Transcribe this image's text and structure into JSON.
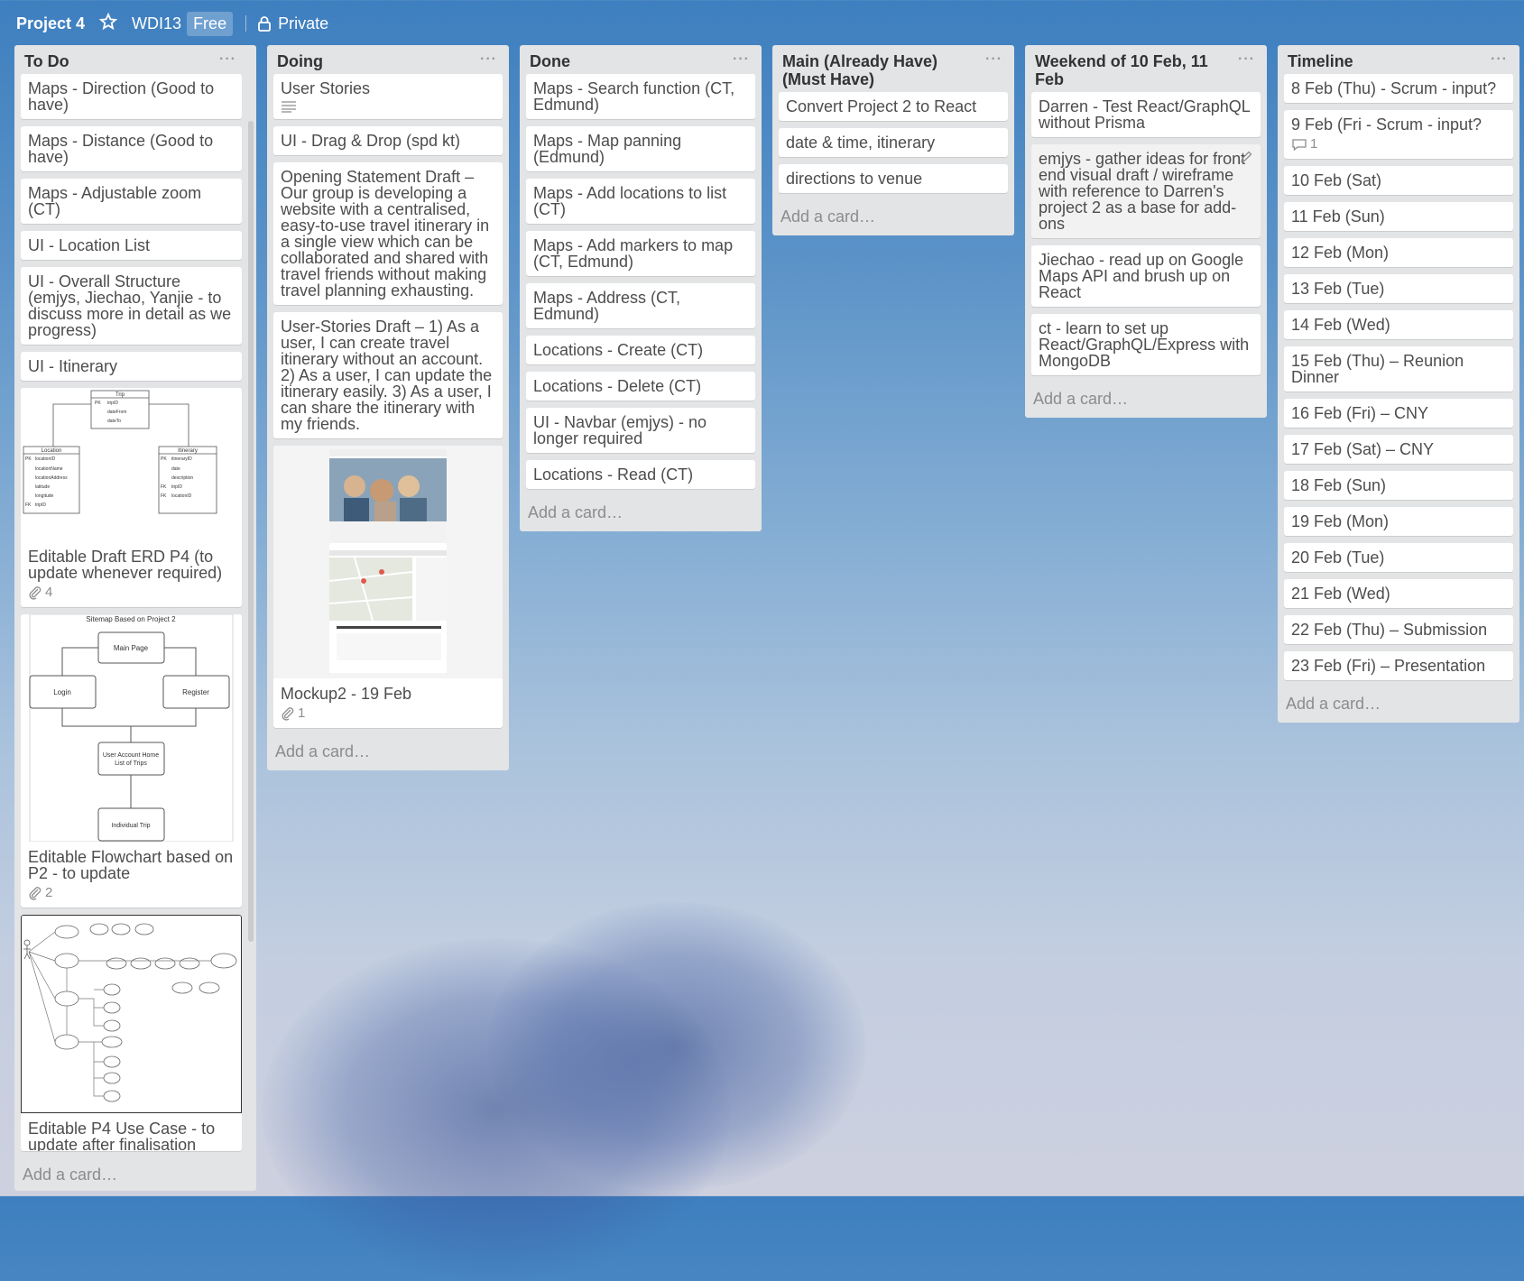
{
  "header": {
    "title": "Project 4",
    "star_icon": "star-icon",
    "workspace": "WDI13",
    "badge": "Free",
    "visibility_icon": "lock-icon",
    "visibility": "Private"
  },
  "lists": [
    {
      "title": "To Do",
      "cards": [
        {
          "text": "Maps - Direction (Good to have)"
        },
        {
          "text": "Maps - Distance (Good to have)"
        },
        {
          "text": "Maps - Adjustable zoom (CT)"
        },
        {
          "text": "UI - Location List"
        },
        {
          "text": "UI - Overall Structure (emjys, Jiechao, Yanjie - to discuss more in detail as we progress)"
        },
        {
          "text": "UI - Itinerary"
        },
        {
          "text": "Editable Draft ERD P4 (to update whenever required)",
          "attachments": "4",
          "erd": {
            "trip": "Trip",
            "trip_fields": [
              "tripID",
              "dateFrom",
              "dateTo"
            ],
            "location": "Location",
            "location_fields": [
              "locationID",
              "locationName",
              "locationAddress",
              "latitude",
              "longitude",
              "tripID"
            ],
            "itinerary": "Itinerary",
            "itinerary_fields": [
              "itineraryID",
              "date",
              "description",
              "tripID",
              "locationID"
            ],
            "pk": "PK",
            "fk": "FK"
          }
        },
        {
          "text": "Editable Flowchart based on P2 - to update",
          "attachments": "2",
          "flow": {
            "title": "Sitemap Based on Project 2",
            "main": "Main Page",
            "login": "Login",
            "register": "Register",
            "home": "User Account Home",
            "home2": "List of Trips",
            "trip": "Individual Trip"
          }
        },
        {
          "text": "Editable P4 Use Case - to update after finalisation"
        }
      ],
      "add": "Add a card…"
    },
    {
      "title": "Doing",
      "cards": [
        {
          "text": "User Stories"
        },
        {
          "text": "UI - Drag & Drop (spd kt)"
        },
        {
          "text": "Opening Statement Draft – Our group is developing a website with a centralised, easy-to-use travel itinerary in a single view which can be collaborated and shared with travel friends without making travel planning exhausting."
        },
        {
          "text": "User-Stories Draft – 1) As a user, I can create travel itinerary without an account. 2) As a user, I can update the itinerary easily. 3) As a user, I can share the itinerary with my friends."
        },
        {
          "text": "Mockup2 - 19 Feb",
          "attachments": "1"
        }
      ],
      "add": "Add a card…"
    },
    {
      "title": "Done",
      "cards": [
        {
          "text": "Maps - Search function (CT, Edmund)"
        },
        {
          "text": "Maps - Map panning (Edmund)"
        },
        {
          "text": "Maps - Add locations to list (CT)"
        },
        {
          "text": "Maps - Add markers to map (CT, Edmund)"
        },
        {
          "text": "Maps - Address (CT, Edmund)"
        },
        {
          "text": "Locations - Create (CT)"
        },
        {
          "text": "Locations - Delete (CT)"
        },
        {
          "text": "UI - Navbar (emjys) - no longer required"
        },
        {
          "text": "Locations - Read (CT)"
        }
      ],
      "add": "Add a card…"
    },
    {
      "title": "Main (Already Have) (Must Have)",
      "cards": [
        {
          "text": "Convert Project 2 to React"
        },
        {
          "text": "date & time, itinerary"
        },
        {
          "text": "directions to venue"
        }
      ],
      "add": "Add a card…"
    },
    {
      "title": "Weekend of 10 Feb, 11 Feb",
      "cards": [
        {
          "text": "Darren - Test React/GraphQL without Prisma"
        },
        {
          "text": "emjys - gather ideas for front end visual draft / wireframe with reference to Darren's project 2 as a base for add-ons"
        },
        {
          "text": "Jiechao - read up on Google Maps API and brush up on React"
        },
        {
          "text": "ct - learn to set up React/GraphQL/Express with MongoDB"
        }
      ],
      "add": "Add a card…"
    },
    {
      "title": "Timeline",
      "cards": [
        {
          "text": "8 Feb (Thu) - Scrum - input?"
        },
        {
          "text": "9 Feb (Fri - Scrum - input?",
          "comments": "1"
        },
        {
          "text": "10 Feb (Sat)"
        },
        {
          "text": "11 Feb (Sun)"
        },
        {
          "text": "12 Feb (Mon)"
        },
        {
          "text": "13 Feb (Tue)"
        },
        {
          "text": "14 Feb (Wed)"
        },
        {
          "text": "15 Feb (Thu) – Reunion Dinner"
        },
        {
          "text": "16 Feb (Fri) – CNY"
        },
        {
          "text": "17 Feb (Sat) – CNY"
        },
        {
          "text": "18 Feb (Sun)"
        },
        {
          "text": "19 Feb (Mon)"
        },
        {
          "text": "20 Feb (Tue)"
        },
        {
          "text": "21 Feb (Wed)"
        },
        {
          "text": "22 Feb (Thu) – Submission"
        },
        {
          "text": "23 Feb (Fri) – Presentation"
        }
      ],
      "add": "Add a card…"
    }
  ],
  "colors": {
    "list_bg": "#e2e4e6",
    "card_bg": "#ffffff",
    "text": "#4d4d4d",
    "muted": "#8c8c8c"
  }
}
